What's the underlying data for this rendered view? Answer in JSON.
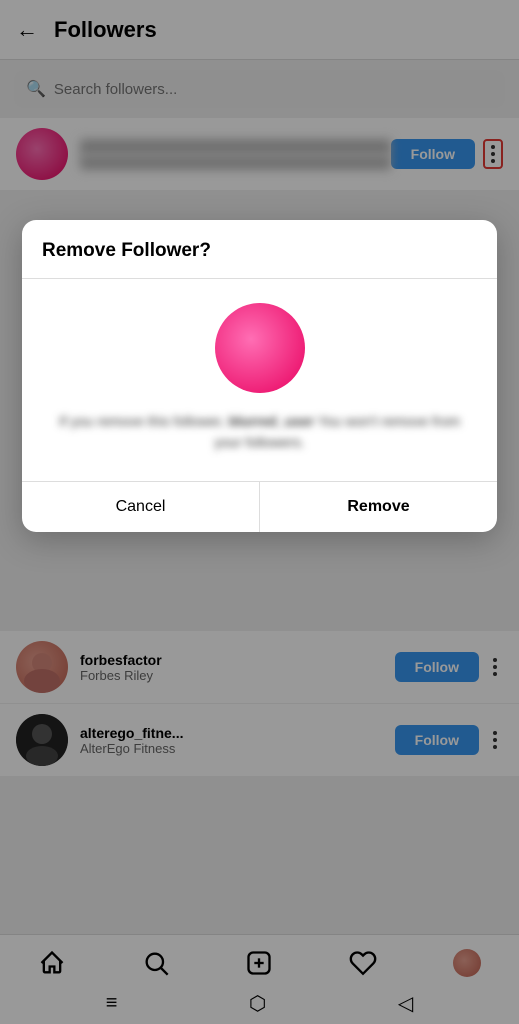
{
  "header": {
    "back_label": "←",
    "title": "Followers"
  },
  "search": {
    "placeholder": "Search followers..."
  },
  "followers": [
    {
      "id": "blurred-user",
      "username": "blurred_user",
      "fullname": "",
      "avatar_type": "pink",
      "follow_label": "Follow",
      "blurred": true
    },
    {
      "id": "forbesfactor",
      "username": "forbesfactor",
      "fullname": "Forbes Riley",
      "avatar_type": "forbesfactor",
      "follow_label": "Follow",
      "blurred": false
    },
    {
      "id": "alterego_fitne",
      "username": "alterego_fitne...",
      "fullname": "AlterEgo Fitness",
      "avatar_type": "alterego",
      "follow_label": "Follow",
      "blurred": false
    }
  ],
  "dialog": {
    "title": "Remove Follower?",
    "body_text_line1": "If you remove this follower,",
    "body_text_line2": "they won't be removed from your followers.",
    "cancel_label": "Cancel",
    "remove_label": "Remove"
  },
  "bottom_nav": {
    "home_icon": "⌂",
    "search_icon": "○",
    "add_icon": "+",
    "heart_icon": "♡",
    "profile_icon": "profile"
  }
}
